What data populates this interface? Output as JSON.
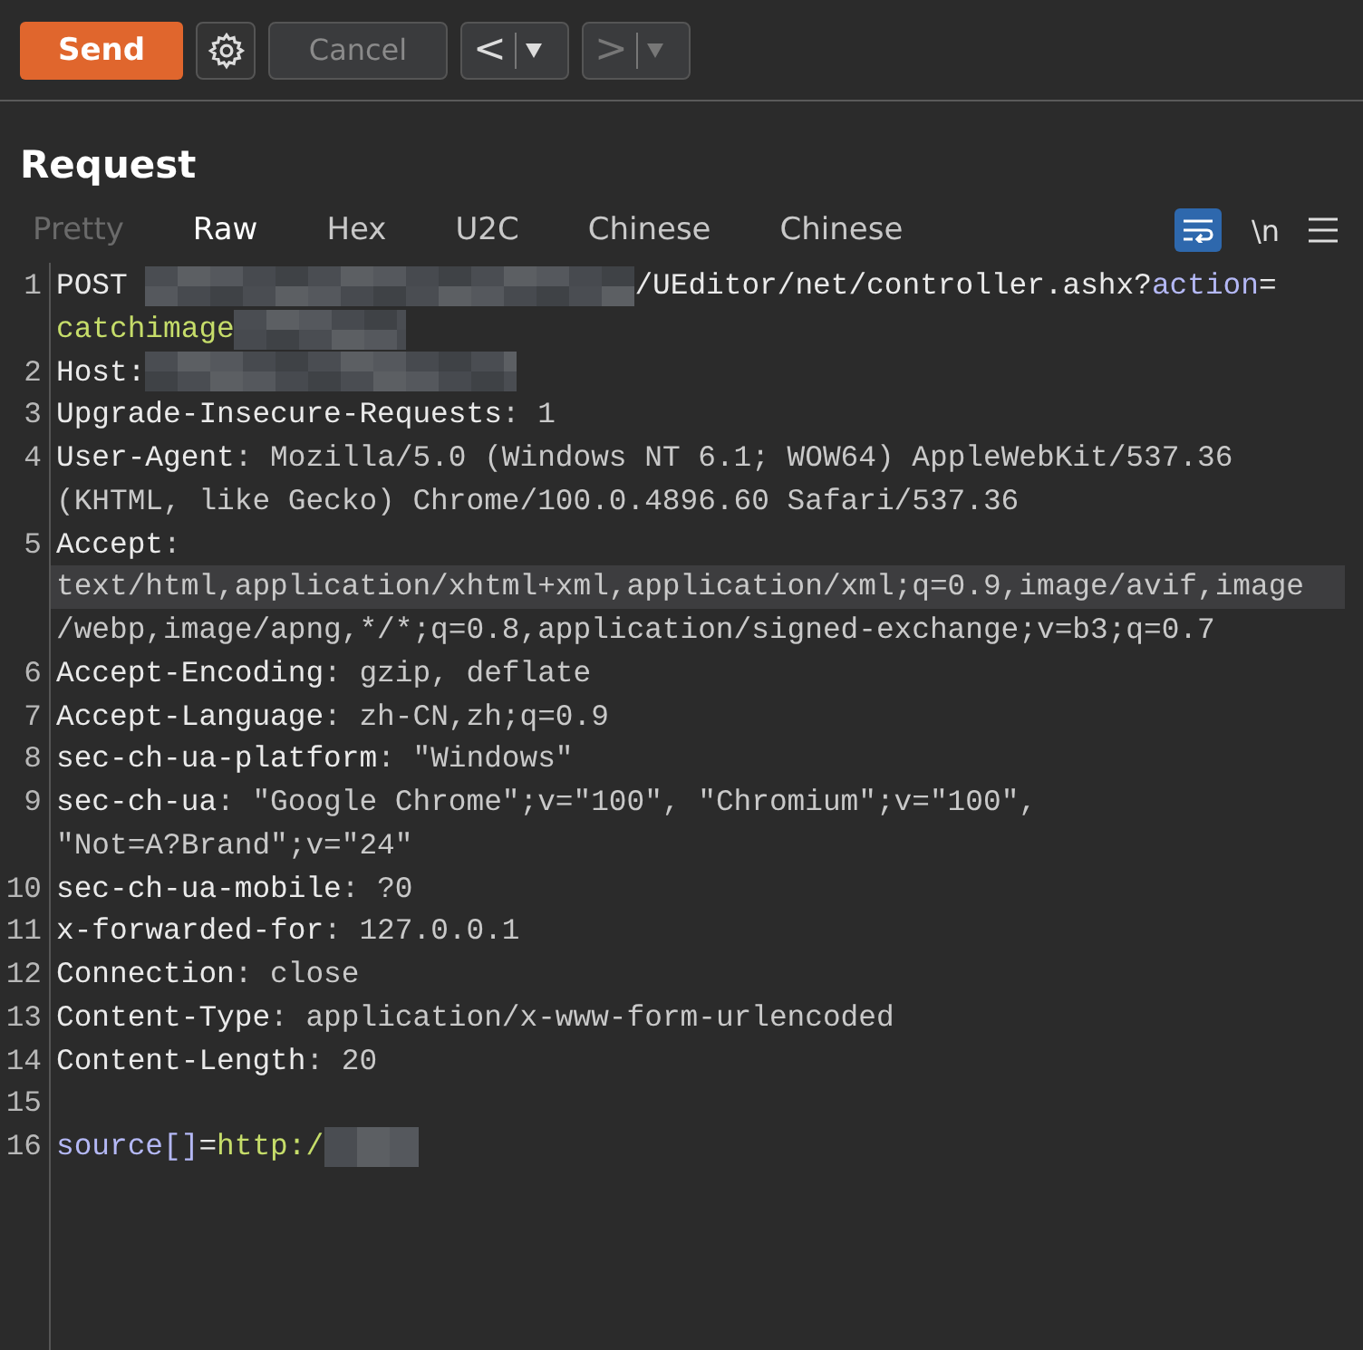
{
  "toolbar": {
    "send": "Send",
    "cancel": "Cancel",
    "back": "<",
    "forward": ">",
    "back_disabled": false,
    "forward_disabled": true
  },
  "panel": {
    "title": "Request"
  },
  "tabs": [
    {
      "label": "Pretty",
      "selected": false,
      "disabled": true
    },
    {
      "label": "Raw",
      "selected": true,
      "disabled": false
    },
    {
      "label": "Hex",
      "selected": false,
      "disabled": false
    },
    {
      "label": "U2C",
      "selected": false,
      "disabled": false
    },
    {
      "label": "Chinese",
      "selected": false,
      "disabled": false
    },
    {
      "label": "Chinese",
      "selected": false,
      "disabled": false
    }
  ],
  "view_options": {
    "wrap_on": true,
    "newline_label": "\\n"
  },
  "lines": [
    {
      "number": "1",
      "rows": [
        {
          "highlighted": false,
          "segments": [
            {
              "kind": "key",
              "text": "POST "
            },
            {
              "kind": "redacted"
            },
            {
              "kind": "key",
              "text": "/UEditor/net/controller.ashx?"
            },
            {
              "kind": "param",
              "text": "action"
            },
            {
              "kind": "key",
              "text": "="
            }
          ]
        },
        {
          "highlighted": false,
          "segments": [
            {
              "kind": "param_value",
              "text": "catchimage"
            },
            {
              "kind": "redacted"
            }
          ]
        }
      ]
    },
    {
      "number": "2",
      "rows": [
        {
          "highlighted": false,
          "segments": [
            {
              "kind": "key",
              "text": "Host:"
            },
            {
              "kind": "redacted"
            }
          ]
        }
      ]
    },
    {
      "number": "3",
      "rows": [
        {
          "highlighted": false,
          "segments": [
            {
              "kind": "key",
              "text": "Upgrade-Insecure-Requests"
            },
            {
              "kind": "value",
              "text": ": 1"
            }
          ]
        }
      ]
    },
    {
      "number": "4",
      "rows": [
        {
          "highlighted": false,
          "segments": [
            {
              "kind": "key",
              "text": "User-Agent"
            },
            {
              "kind": "value",
              "text": ": Mozilla/5.0 (Windows NT 6.1; WOW64) AppleWebKit/537.36"
            }
          ]
        },
        {
          "highlighted": false,
          "segments": [
            {
              "kind": "value",
              "text": "(KHTML, like Gecko) Chrome/100.0.4896.60 Safari/537.36"
            }
          ]
        }
      ]
    },
    {
      "number": "5",
      "rows": [
        {
          "highlighted": false,
          "segments": [
            {
              "kind": "key",
              "text": "Accept"
            },
            {
              "kind": "value",
              "text": ":"
            }
          ]
        },
        {
          "highlighted": true,
          "segments": [
            {
              "kind": "value",
              "text": "text/html,application/xhtml+xml,application/xml;q=0.9,image/avif,image"
            }
          ]
        },
        {
          "highlighted": false,
          "segments": [
            {
              "kind": "value",
              "text": "/webp,image/apng,*/*;q=0.8,application/signed-exchange;v=b3;q=0.7"
            }
          ]
        }
      ]
    },
    {
      "number": "6",
      "rows": [
        {
          "highlighted": false,
          "segments": [
            {
              "kind": "key",
              "text": "Accept-Encoding"
            },
            {
              "kind": "value",
              "text": ": gzip, deflate"
            }
          ]
        }
      ]
    },
    {
      "number": "7",
      "rows": [
        {
          "highlighted": false,
          "segments": [
            {
              "kind": "key",
              "text": "Accept-Language"
            },
            {
              "kind": "value",
              "text": ": zh-CN,zh;q=0.9"
            }
          ]
        }
      ]
    },
    {
      "number": "8",
      "rows": [
        {
          "highlighted": false,
          "segments": [
            {
              "kind": "key",
              "text": "sec-ch-ua-platform"
            },
            {
              "kind": "value",
              "text": ": \"Windows\""
            }
          ]
        }
      ]
    },
    {
      "number": "9",
      "rows": [
        {
          "highlighted": false,
          "segments": [
            {
              "kind": "key",
              "text": "sec-ch-ua"
            },
            {
              "kind": "value",
              "text": ": \"Google Chrome\";v=\"100\", \"Chromium\";v=\"100\","
            }
          ]
        },
        {
          "highlighted": false,
          "segments": [
            {
              "kind": "value",
              "text": "\"Not=A?Brand\";v=\"24\""
            }
          ]
        }
      ]
    },
    {
      "number": "10",
      "rows": [
        {
          "highlighted": false,
          "segments": [
            {
              "kind": "key",
              "text": "sec-ch-ua-mobile"
            },
            {
              "kind": "value",
              "text": ": ?0"
            }
          ]
        }
      ]
    },
    {
      "number": "11",
      "rows": [
        {
          "highlighted": false,
          "segments": [
            {
              "kind": "key",
              "text": "x-forwarded-for"
            },
            {
              "kind": "value",
              "text": ": 127.0.0.1"
            }
          ]
        }
      ]
    },
    {
      "number": "12",
      "rows": [
        {
          "highlighted": false,
          "segments": [
            {
              "kind": "key",
              "text": "Connection"
            },
            {
              "kind": "value",
              "text": ": close"
            }
          ]
        }
      ]
    },
    {
      "number": "13",
      "rows": [
        {
          "highlighted": false,
          "segments": [
            {
              "kind": "key",
              "text": "Content-Type"
            },
            {
              "kind": "value",
              "text": ": application/x-www-form-urlencoded"
            }
          ]
        }
      ]
    },
    {
      "number": "14",
      "rows": [
        {
          "highlighted": false,
          "segments": [
            {
              "kind": "key",
              "text": "Content-Length"
            },
            {
              "kind": "value",
              "text": ": 20"
            }
          ]
        }
      ]
    },
    {
      "number": "15"
    },
    {
      "number": "16",
      "rows": [
        {
          "highlighted": false,
          "segments": [
            {
              "kind": "param",
              "text": "source[]"
            },
            {
              "kind": "key",
              "text": "="
            },
            {
              "kind": "param_value",
              "text": "http:/"
            },
            {
              "kind": "redacted"
            }
          ]
        }
      ]
    }
  ]
}
